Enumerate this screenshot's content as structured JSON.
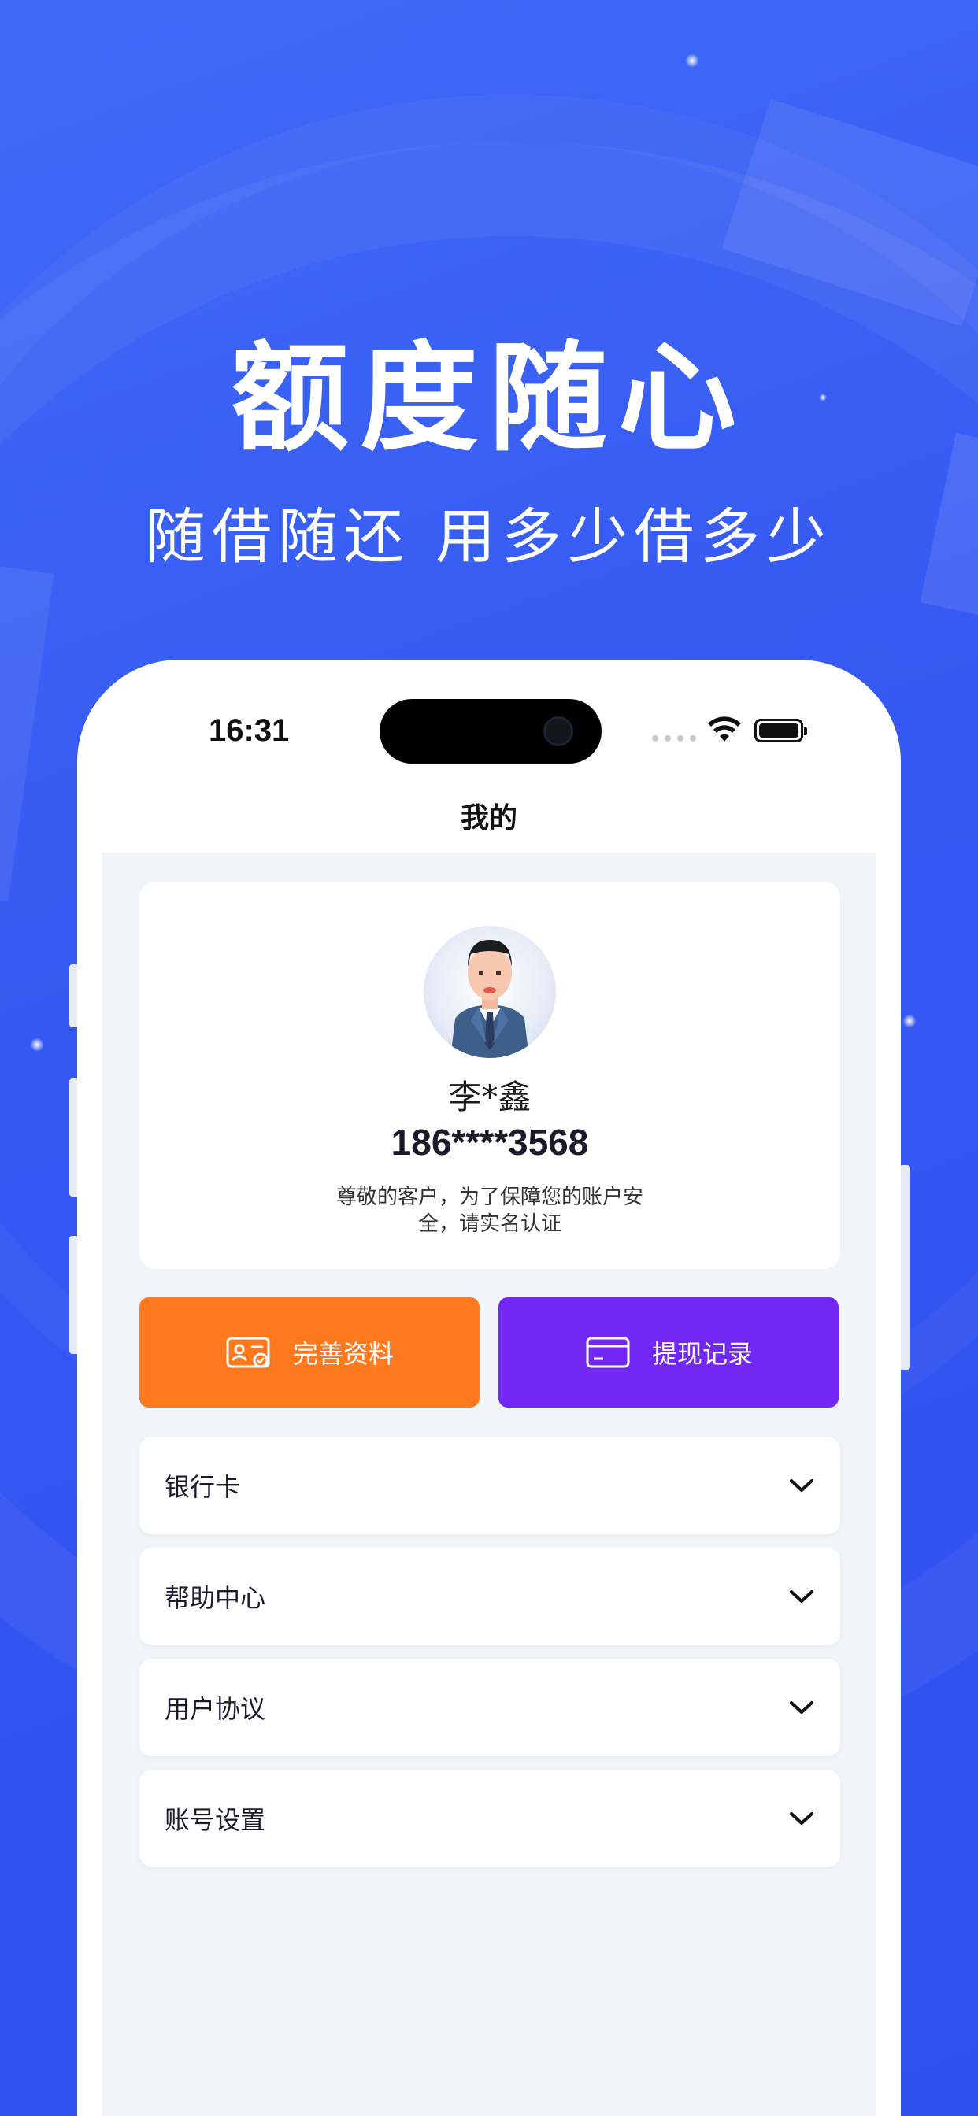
{
  "hero": {
    "title": "额度随心",
    "subtitle": "随借随还 用多少借多少"
  },
  "status_bar": {
    "time": "16:31",
    "icons": [
      "signal-dots-icon",
      "wifi-icon",
      "battery-icon"
    ]
  },
  "nav": {
    "title": "我的"
  },
  "profile": {
    "avatar": "avatar-man-suit",
    "name": "李*鑫",
    "phone": "186****3568",
    "notice": "尊敬的客户，为了保障您的账户安全，请实名认证"
  },
  "actions": [
    {
      "label": "完善资料",
      "icon": "id-card-icon",
      "color": "#ff7a1f"
    },
    {
      "label": "提现记录",
      "icon": "card-icon",
      "color": "#7327f5"
    }
  ],
  "menu": [
    {
      "label": "银行卡"
    },
    {
      "label": "帮助中心"
    },
    {
      "label": "用户协议"
    },
    {
      "label": "账号设置"
    }
  ],
  "colors": {
    "background": "#3a5ff5",
    "orange": "#ff7a1f",
    "purple": "#7327f5",
    "content_bg": "#f1f4f8"
  }
}
